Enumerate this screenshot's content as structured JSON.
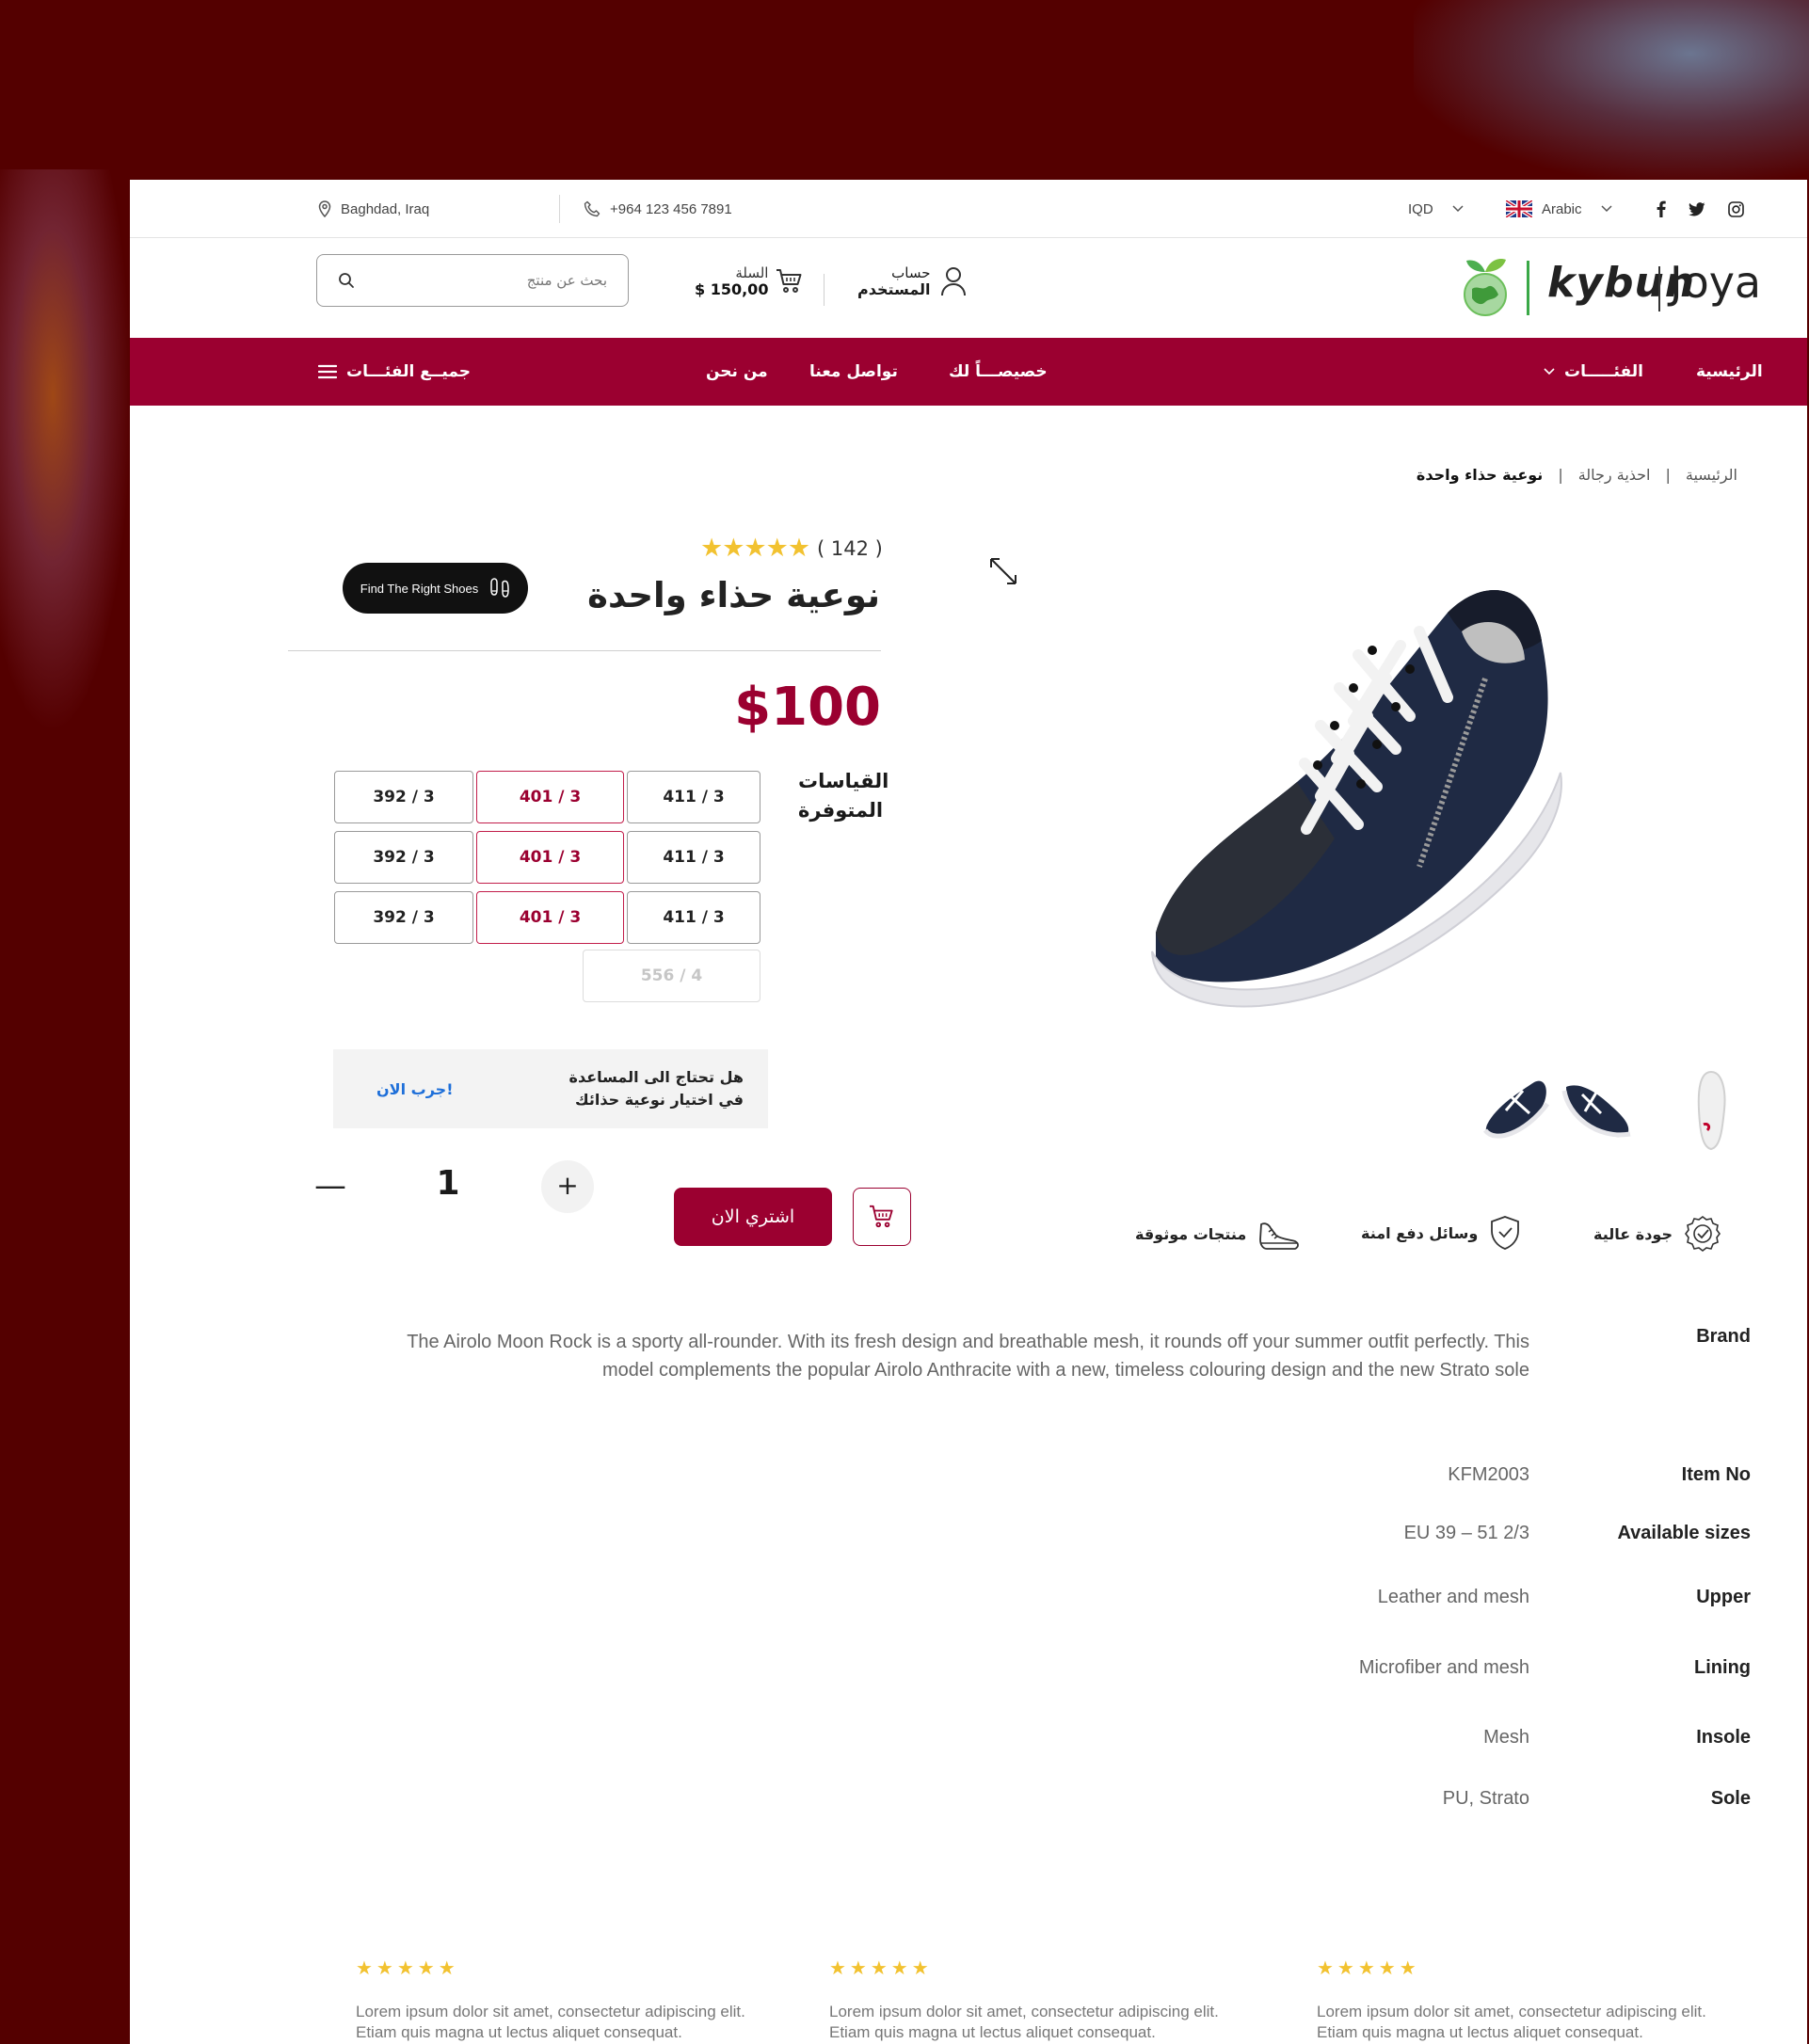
{
  "topbar": {
    "location": "Baghdad, Iraq",
    "phone": "+964 123 456 7891",
    "currency": "IQD",
    "language": "Arabic"
  },
  "header": {
    "search_placeholder": "بحث عن منتج",
    "cart_label": "السلة",
    "cart_total": "$ 150,00",
    "account_line1": "حساب",
    "account_line2": "المستخدم",
    "logo_kybun": "kybun",
    "logo_joya": "Joya"
  },
  "nav": {
    "home": "الرئيسية",
    "categories": "الفئـــــات",
    "special": "خصيصـــاً لك",
    "contact": "تواصل معنا",
    "about": "من نحن",
    "all_categories": "جميــع الفئـــات"
  },
  "breadcrumb": {
    "home": "الرئيسية",
    "sep": "|",
    "category": "احذية رجالة",
    "current": "نوعية حذاء واحدة"
  },
  "product": {
    "rating_stars": "★★★★★",
    "rating_count": "( 142 )",
    "title": "نوعية حذاء واحدة",
    "find_button": "Find The Right Shoes",
    "price": "$100",
    "sizes_label": "القياسات المتوفرة",
    "sizes": [
      [
        "411 / 3",
        "401 / 3",
        "392 / 3"
      ],
      [
        "411 / 3",
        "401 / 3",
        "392 / 3"
      ],
      [
        "411 / 3",
        "401 / 3",
        "392 / 3"
      ]
    ],
    "size_disabled": "556 / 4",
    "help_line1": "هل تحتاج الى المساعدة",
    "help_line2": "في اختيار نوعية حذائك",
    "help_try": "جرب الان!",
    "quantity": "1",
    "buy_now": "اشتري الان"
  },
  "features": {
    "quality": "جودة عالية",
    "payment": "وسائل دفع امنة",
    "trusted": "منتجات موثوقة"
  },
  "specs": {
    "brand_key": "Brand",
    "brand_desc": "The Airolo Moon Rock is a sporty all-rounder. With its fresh design and breathable mesh, it rounds off your summer outfit perfectly. This model complements the popular Airolo Anthracite with a new, timeless colouring design and the new Strato sole",
    "item_no_key": "Item No",
    "item_no": "KFM2003",
    "sizes_key": "Available sizes",
    "sizes_val": "EU 39 – 51 2/3",
    "upper_key": "Upper",
    "upper_val": "Leather and mesh",
    "lining_key": "Lining",
    "lining_val": "Microfiber and mesh",
    "insole_key": "Insole",
    "insole_val": "Mesh",
    "sole_key": "Sole",
    "sole_val": "PU, Strato"
  },
  "reviews": [
    {
      "stars": "★★★★★",
      "text": "Lorem ipsum dolor sit amet, consectetur adipiscing elit. Etiam quis magna ut lectus aliquet consequat."
    },
    {
      "stars": "★★★★★",
      "text": "Lorem ipsum dolor sit amet, consectetur adipiscing elit. Etiam quis magna ut lectus aliquet consequat."
    },
    {
      "stars": "★★★★★",
      "text": "Lorem ipsum dolor sit amet, consectetur adipiscing elit. Etiam quis magna ut lectus aliquet consequat."
    }
  ],
  "colors": {
    "brand": "#9b0030",
    "backdrop": "#540000",
    "star": "#f2c230",
    "link": "#1e6fd9"
  },
  "icons": [
    "location-pin-icon",
    "phone-icon",
    "chevron-down-icon",
    "uk-flag-icon",
    "facebook-icon",
    "twitter-icon",
    "instagram-icon",
    "search-icon",
    "cart-icon",
    "user-icon",
    "menu-icon",
    "expand-icon",
    "shoe-scan-icon",
    "quality-badge-icon",
    "shield-check-icon",
    "sneaker-icon"
  ]
}
